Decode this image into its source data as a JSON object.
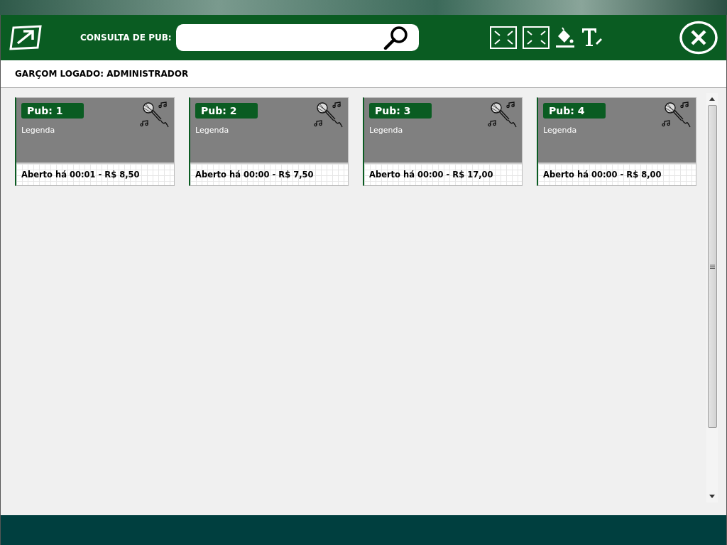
{
  "header": {
    "search_label": "CONSULTA DE PUB:"
  },
  "user_bar": {
    "text": "GARÇOM LOGADO: ADMINISTRADOR"
  },
  "pubs": [
    {
      "title": "Pub: 1",
      "caption": "Legenda",
      "status": "Aberto há 00:01 - R$ 8,50"
    },
    {
      "title": "Pub: 2",
      "caption": "Legenda",
      "status": "Aberto há 00:00 - R$ 7,50"
    },
    {
      "title": "Pub: 3",
      "caption": "Legenda",
      "status": "Aberto há 00:00 - R$ 17,00"
    },
    {
      "title": "Pub: 4",
      "caption": "Legenda",
      "status": "Aberto há 00:00 - R$ 8,00"
    }
  ]
}
